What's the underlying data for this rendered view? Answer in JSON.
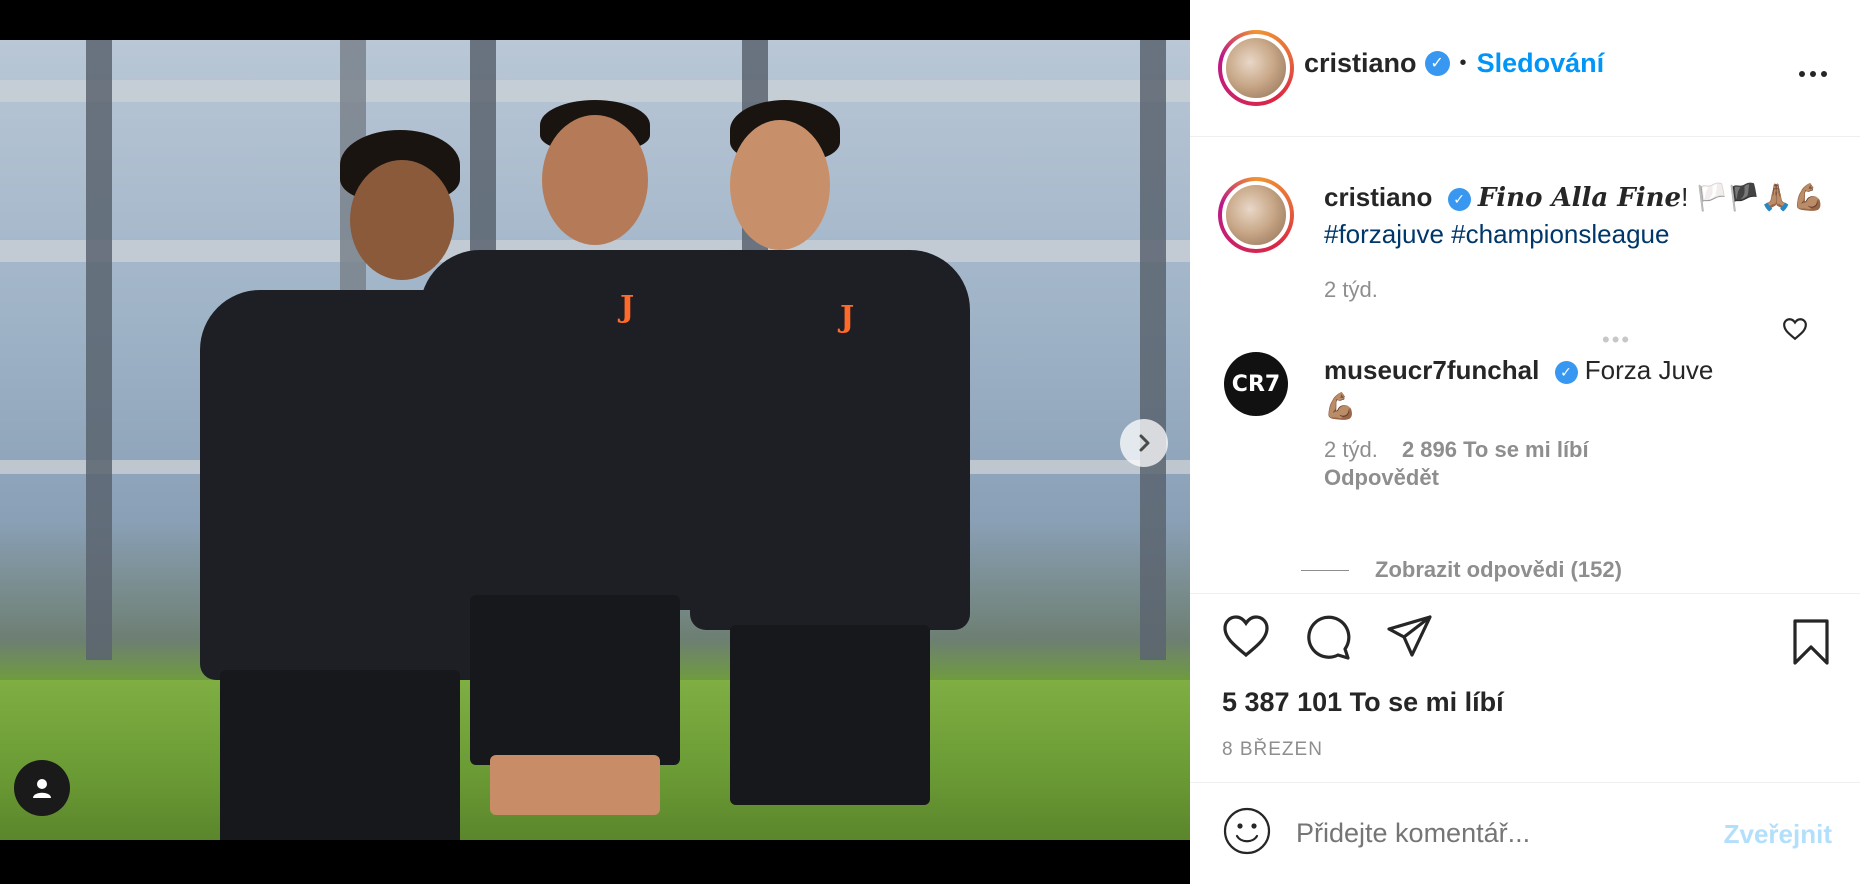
{
  "post": {
    "username": "cristiano",
    "follow_label": "Sledování",
    "separator": "•",
    "more_icon": "more-horizontal-icon",
    "caption": {
      "username": "cristiano",
      "script_text": "Fino Alla Fine",
      "text_after": "! 🏳️🏴🙏🏽💪🏽",
      "hashtags": "#forzajuve #championsleague",
      "age": "2 týd."
    },
    "top_comment": {
      "username": "museucr7funchal",
      "avatar_text": "CR7",
      "text": "Forza Juve",
      "emoji": "💪🏽",
      "age": "2 týd.",
      "likes": "2 896 To se mi líbí",
      "reply_label": "Odpovědět",
      "view_replies": "Zobrazit odpovědi (152)"
    },
    "likes_count": "5 387 101 To se mi líbí",
    "date": "8 BŘEZEN",
    "comment_placeholder": "Přidejte komentář...",
    "post_button": "Zveřejnit"
  },
  "media": {
    "next_icon": "chevron-right-icon",
    "tag_icon": "user-tag-icon",
    "carousel_total": 2,
    "carousel_active": 1
  },
  "colors": {
    "accent": "#0095f6",
    "verified": "#3897f0",
    "muted": "#8e8e8e",
    "post_disabled": "#b2dffc"
  }
}
